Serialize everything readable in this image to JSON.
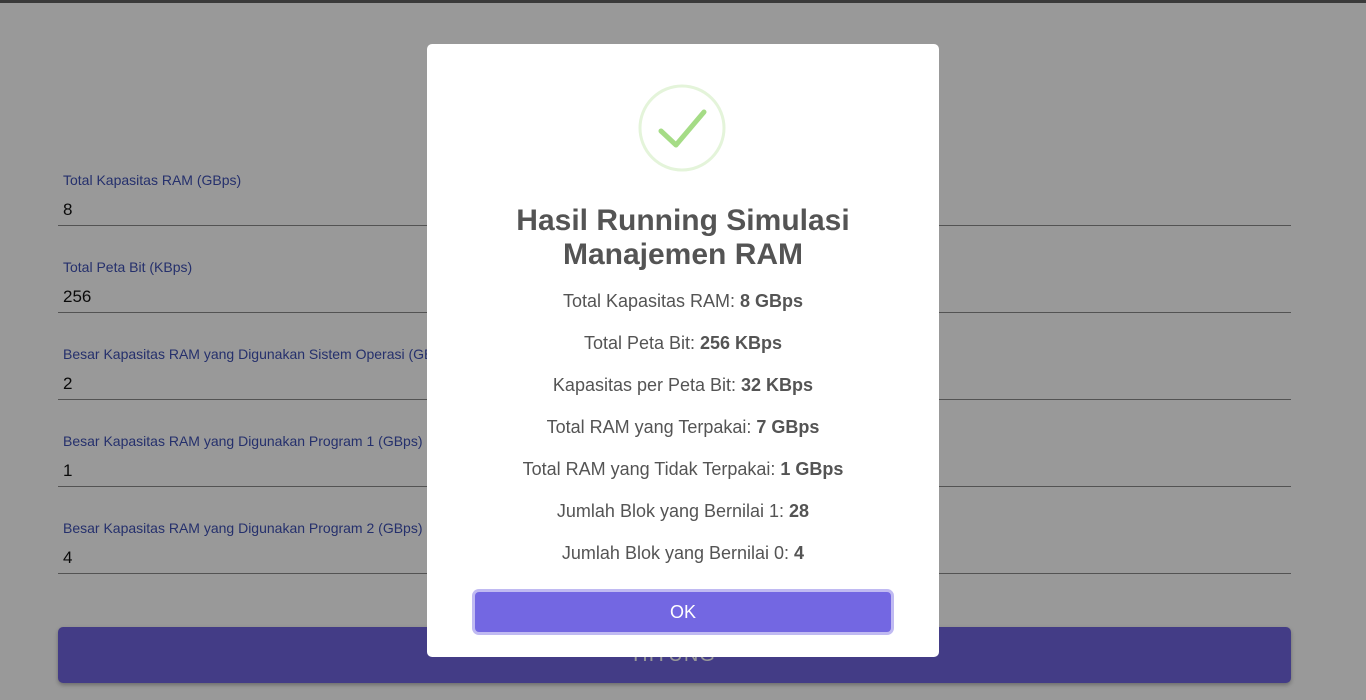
{
  "form": {
    "fields": [
      {
        "label": "Total Kapasitas RAM (GBps)",
        "value": "8"
      },
      {
        "label": "Total Peta Bit (KBps)",
        "value": "256"
      },
      {
        "label": "Besar Kapasitas RAM yang Digunakan Sistem Operasi (GBps)",
        "value": "2"
      },
      {
        "label": "Besar Kapasitas RAM yang Digunakan Program 1 (GBps)",
        "value": "1"
      },
      {
        "label": "Besar Kapasitas RAM yang Digunakan Program 2 (GBps)",
        "value": "4"
      }
    ],
    "submit_label": "HITUNG"
  },
  "modal": {
    "icon": "success-check-icon",
    "title": "Hasil Running Simulasi Manajemen RAM",
    "rows": [
      {
        "label": "Total Kapasitas RAM: ",
        "value": "8 GBps"
      },
      {
        "label": "Total Peta Bit: ",
        "value": "256 KBps"
      },
      {
        "label": "Kapasitas per Peta Bit: ",
        "value": "32 KBps"
      },
      {
        "label": "Total RAM yang Terpakai: ",
        "value": "7 GBps"
      },
      {
        "label": "Total RAM yang Tidak Terpakai: ",
        "value": "1 GBps"
      },
      {
        "label": "Jumlah Blok yang Bernilai 1: ",
        "value": "28"
      },
      {
        "label": "Jumlah Blok yang Bernilai 0: ",
        "value": "4"
      }
    ],
    "ok_label": "OK"
  },
  "colors": {
    "accent": "#7367e2",
    "field_label": "#3f51b5",
    "success": "#a5dc86"
  }
}
